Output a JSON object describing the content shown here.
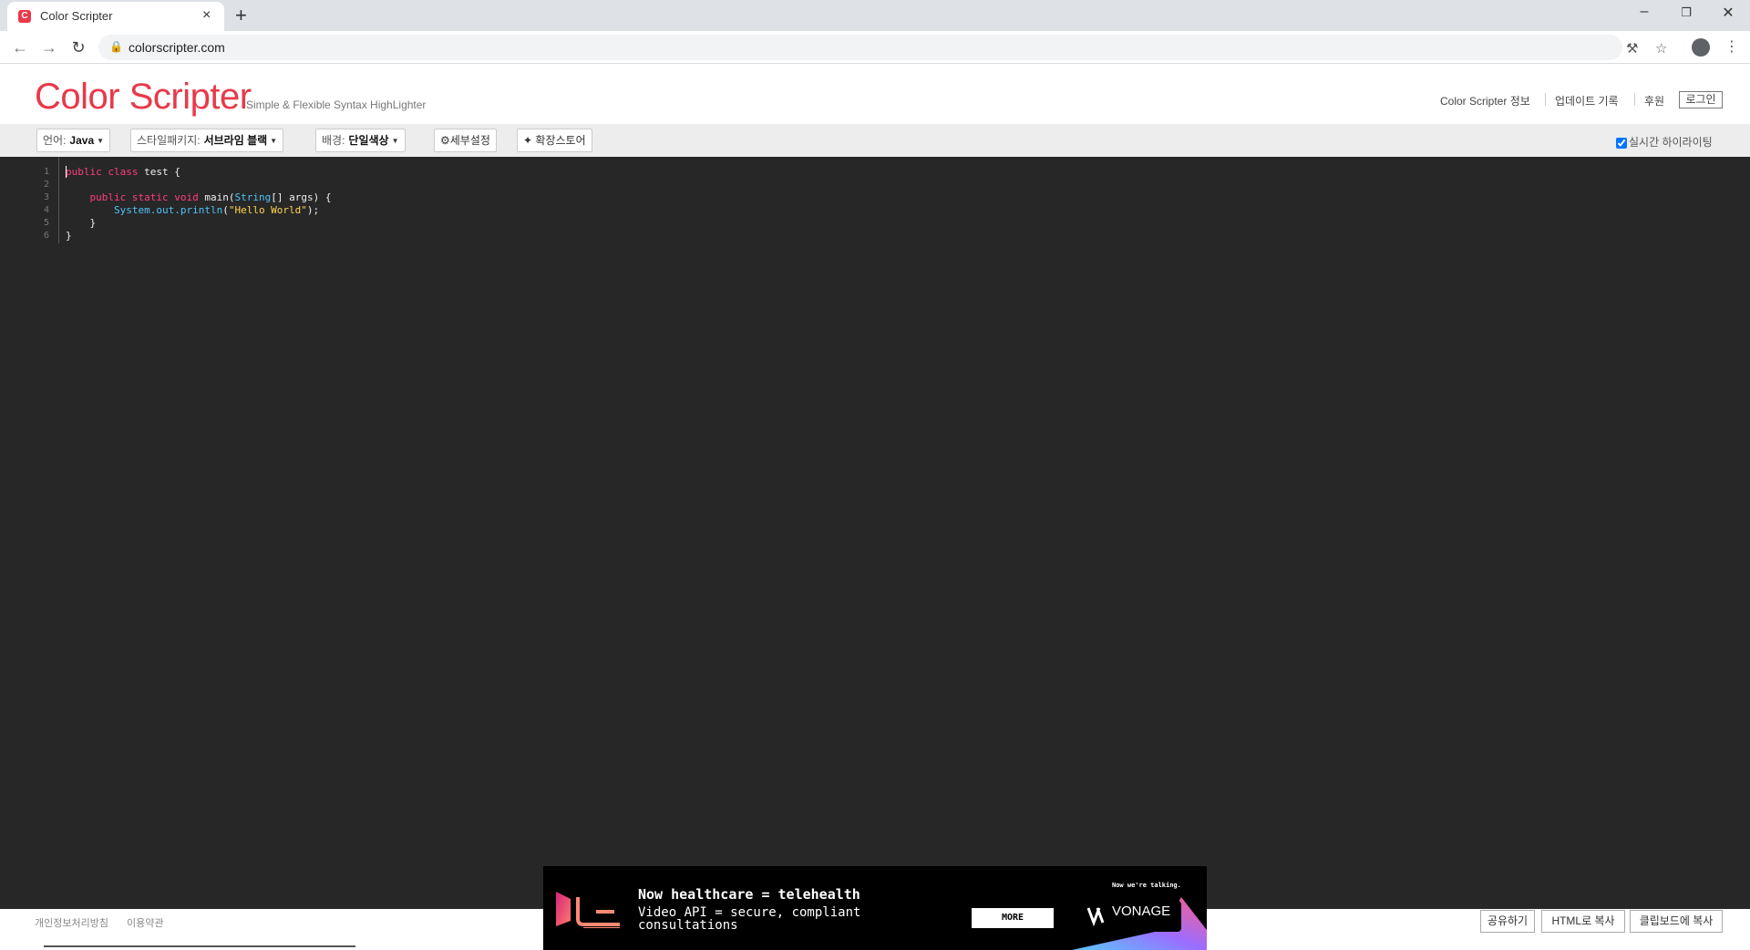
{
  "browser": {
    "tab_title": "Color Scripter",
    "url": "colorscripter.com",
    "new_tab": "+",
    "tab_close": "×"
  },
  "header": {
    "logo": "Color Scripter",
    "tagline": "Simple & Flexible Syntax HighLighter",
    "links": {
      "about": "Color Scripter 정보",
      "updates": "업데이트 기록",
      "donate": "후원",
      "login": "로그인"
    }
  },
  "toolbar": {
    "language_label": "언어:",
    "language_value": "Java",
    "style_label": "스타일패키지:",
    "style_value": "서브라임 블랙",
    "background_label": "배경:",
    "background_value": "단일색상",
    "settings": "세부설정",
    "store": "확장스토어",
    "realtime": "실시간 하이라이팅",
    "realtime_checked": true
  },
  "editor": {
    "line_numbers": [
      "1",
      "2",
      "3",
      "4",
      "5",
      "6"
    ],
    "code": {
      "l1_kw1": "public",
      "l1_kw2": "class",
      "l1_rest": " test {",
      "l3_kw1": "public",
      "l3_kw2": "static",
      "l3_kw3": "void",
      "l3_a": " main(",
      "l3_type": "String",
      "l3_b": "[] args) {",
      "l4_type": "System.out.println",
      "l4_a": "(",
      "l4_str": "\"Hello World\"",
      "l4_b": ");",
      "l5": "}",
      "l6": "}"
    },
    "colors": {
      "background": "#272727",
      "keyword": "#ff3d7f",
      "type": "#4fc3f7",
      "string": "#ffd54f"
    }
  },
  "footer": {
    "privacy": "개인정보처리방침",
    "terms": "이용약관",
    "share": "공유하기",
    "copy_html": "HTML로 복사",
    "copy_clipboard": "클립보드에 복사"
  },
  "ad": {
    "headline": "Now healthcare = telehealth",
    "body_line1": "Video API = secure, compliant",
    "body_line2": "consultations",
    "cta": "MORE",
    "tagline": "Now we're talking.",
    "brand": "VONAGE"
  }
}
